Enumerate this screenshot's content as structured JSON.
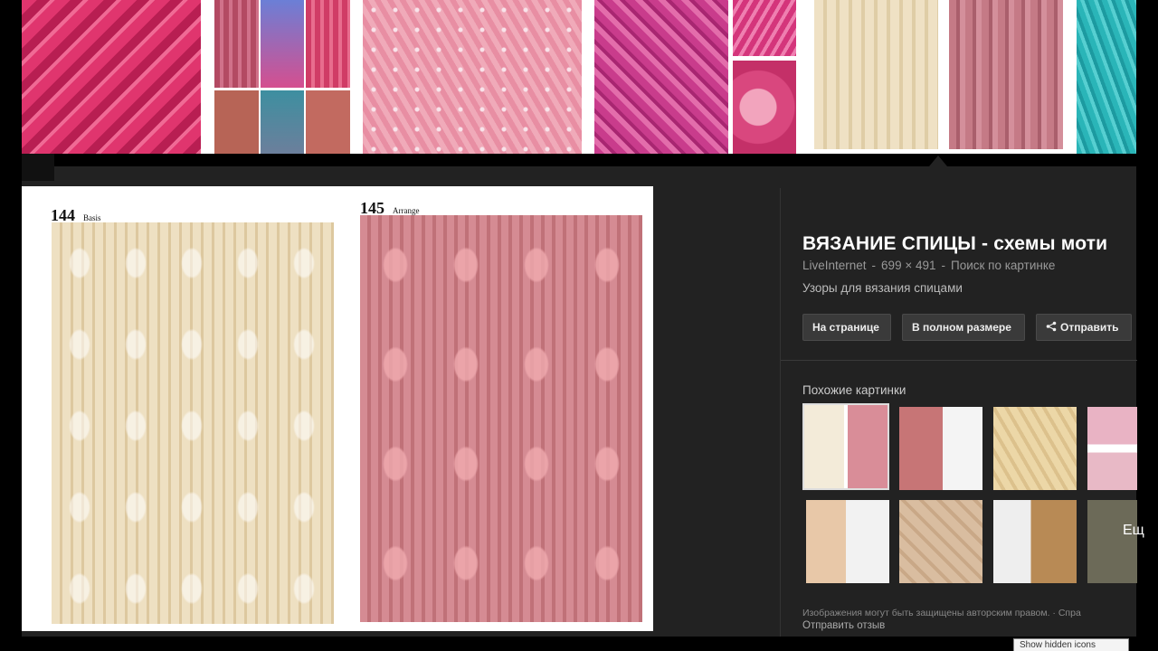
{
  "preview": {
    "page_left_number": "144",
    "page_left_label": "Basis",
    "page_right_number": "145",
    "page_right_label": "Arrange"
  },
  "info": {
    "title": "ВЯЗАНИЕ СПИЦЫ - схемы моти",
    "source": "LiveInternet",
    "separator": "-",
    "dimensions": "699 × 491",
    "search_by_image": "Поиск по картинке",
    "description": "Узоры для вязания спицами"
  },
  "buttons": {
    "on_page": "На странице",
    "full_size": "В полном размере",
    "share": "Отправить"
  },
  "similar": {
    "heading": "Похожие картинки",
    "more": "Ещ"
  },
  "footer": {
    "copyright": "Изображения могут быть защищены авторским правом. · Спра",
    "feedback": "Отправить отзыв"
  },
  "tooltip": "Show hidden icons"
}
